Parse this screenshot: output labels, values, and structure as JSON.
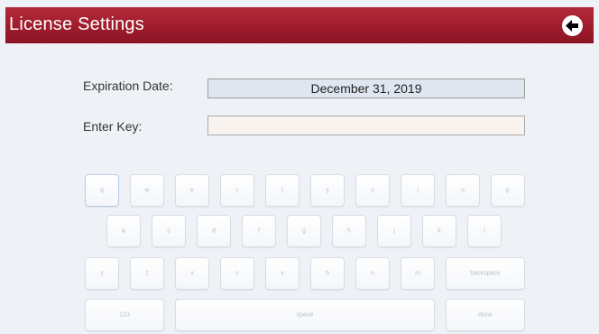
{
  "header": {
    "title": "License Settings"
  },
  "fields": {
    "expiration_label": "Expiration Date:",
    "expiration_value": "December 31, 2019",
    "key_label": "Enter Key:",
    "key_value": ""
  },
  "keyboard": {
    "row1": [
      "q",
      "w",
      "e",
      "r",
      "t",
      "y",
      "u",
      "i",
      "o",
      "p"
    ],
    "row2": [
      "a",
      "s",
      "d",
      "f",
      "g",
      "h",
      "j",
      "k",
      "l"
    ],
    "row3": [
      "⇧",
      "z",
      "x",
      "c",
      "v",
      "b",
      "n",
      "m",
      "backspace"
    ],
    "row4": [
      "123",
      "space",
      "done"
    ]
  },
  "icons": {
    "back": "back-arrow-icon"
  },
  "colors": {
    "titlebar": "#9f1c2c",
    "background": "#eef2f7"
  }
}
